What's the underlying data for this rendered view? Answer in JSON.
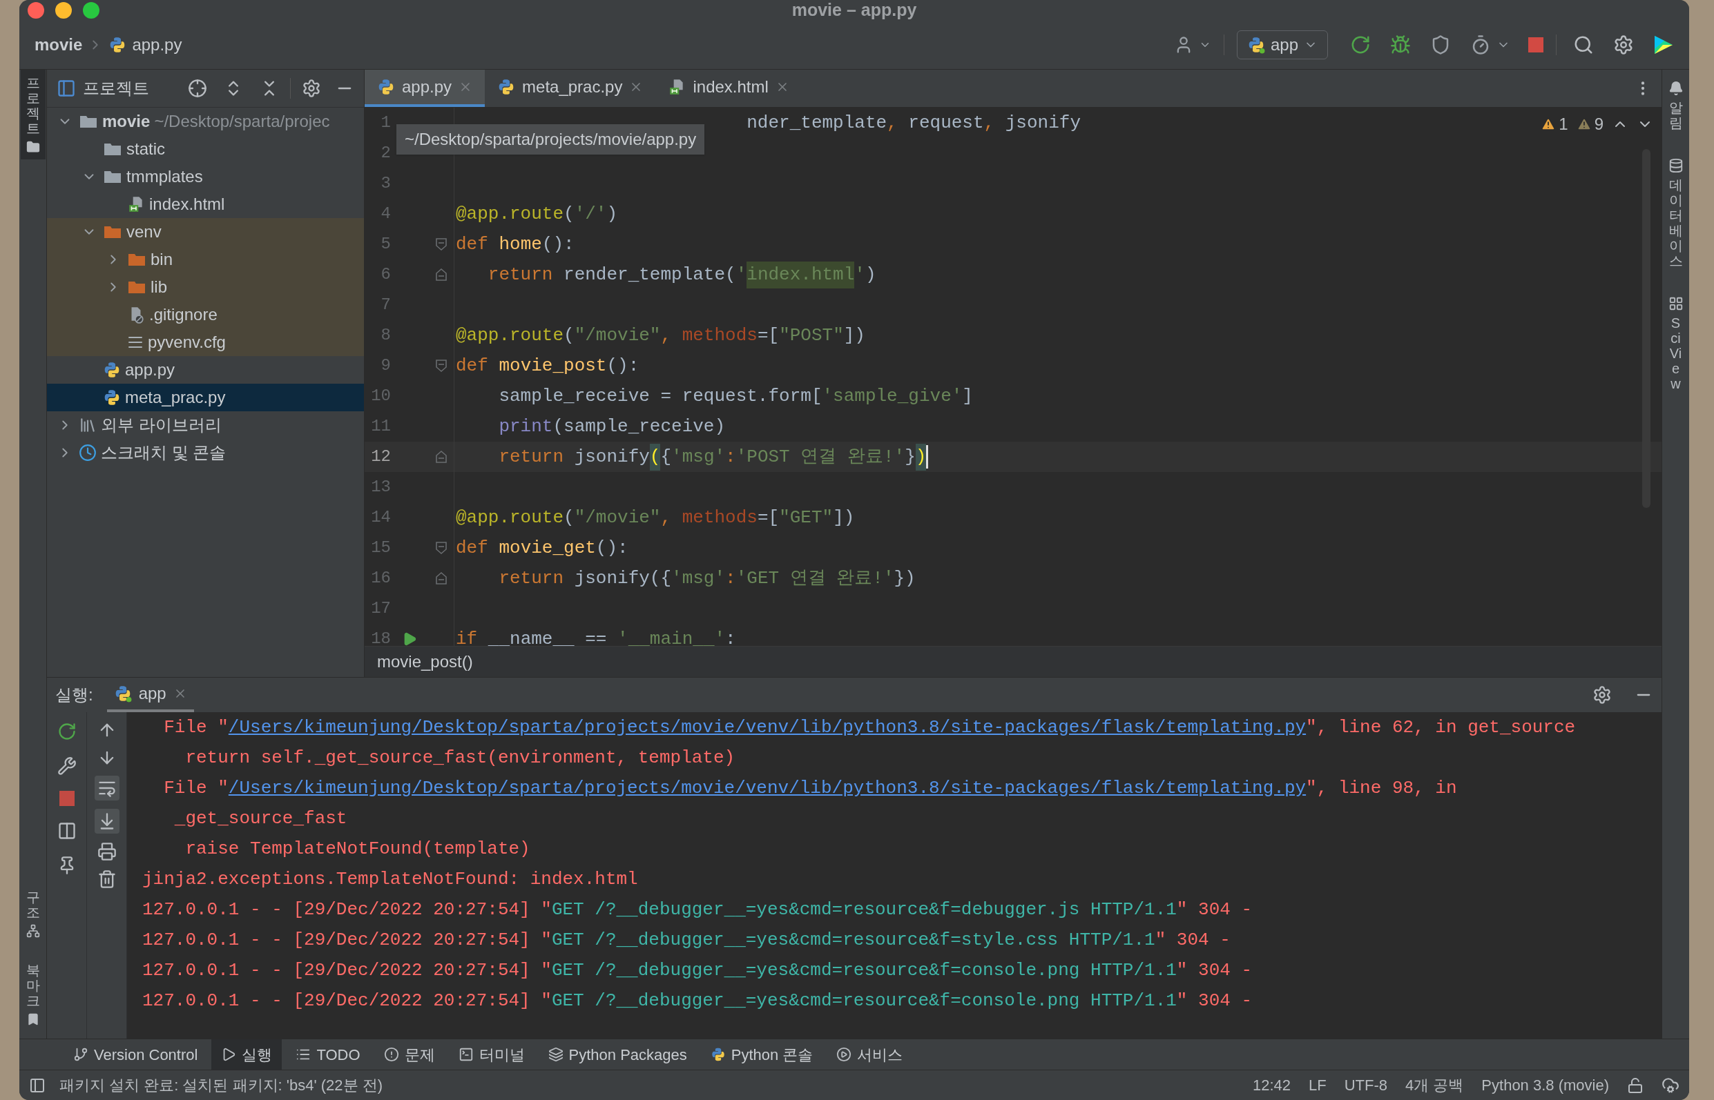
{
  "window": {
    "title": "movie – app.py"
  },
  "breadcrumb": [
    "movie",
    "app.py"
  ],
  "toolbar": {
    "run_config": "app"
  },
  "left_tool_tabs": [
    {
      "label": "프로젝트",
      "selected": true
    }
  ],
  "left_bottom_tabs": [
    {
      "label": "구조",
      "selected": false
    },
    {
      "label": "북마크",
      "selected": false
    }
  ],
  "right_tool_tabs": [
    {
      "label": "알림",
      "selected": false
    },
    {
      "label": "데이터베이스",
      "selected": false
    },
    {
      "label": "SciView",
      "selected": false
    }
  ],
  "project_panel": {
    "title": "프로젝트",
    "tree": [
      {
        "label": "movie",
        "hint": "~/Desktop/sparta/projec",
        "kind": "folder",
        "expanded": true,
        "selected": false,
        "excluded": false,
        "children": [
          {
            "label": "static",
            "kind": "folder",
            "selected": false,
            "excluded": false
          },
          {
            "label": "tmmplates",
            "kind": "folder",
            "expanded": true,
            "selected": false,
            "excluded": false,
            "children": [
              {
                "label": "index.html",
                "kind": "html",
                "selected": false,
                "excluded": false
              }
            ]
          },
          {
            "label": "venv",
            "kind": "folder",
            "expanded": true,
            "selected": false,
            "excluded": true,
            "children": [
              {
                "label": "bin",
                "kind": "folder",
                "expanded": false,
                "selected": false,
                "excluded": true
              },
              {
                "label": "lib",
                "kind": "folder",
                "expanded": false,
                "selected": false,
                "excluded": true
              },
              {
                "label": ".gitignore",
                "kind": "ignore",
                "selected": false,
                "excluded": true
              },
              {
                "label": "pyvenv.cfg",
                "kind": "config",
                "selected": false,
                "excluded": true
              }
            ]
          },
          {
            "label": "app.py",
            "kind": "python",
            "selected": false,
            "excluded": false
          },
          {
            "label": "meta_prac.py",
            "kind": "python",
            "selected": true,
            "excluded": false
          }
        ]
      },
      {
        "label": "외부 라이브러리",
        "kind": "library",
        "expanded": false,
        "selected": false,
        "excluded": false
      },
      {
        "label": "스크래치 및 콘솔",
        "kind": "scratch",
        "expanded": false,
        "selected": false,
        "excluded": false
      }
    ]
  },
  "editor": {
    "tabs": [
      {
        "label": "app.py",
        "kind": "python",
        "selected": true
      },
      {
        "label": "meta_prac.py",
        "kind": "python",
        "selected": false
      },
      {
        "label": "index.html",
        "kind": "html",
        "selected": false
      }
    ],
    "tooltip": "~/Desktop/sparta/projects/movie/app.py",
    "inspections": [
      {
        "count": "1",
        "kind": "warning"
      },
      {
        "count": "9",
        "kind": "weak"
      }
    ],
    "lines": [
      {
        "number": "1",
        "current": false,
        "tokens": [
          {
            "kind": "plain",
            "t": "                           nder_template"
          },
          {
            "kind": "kw",
            "t": ", "
          },
          {
            "kind": "plain",
            "t": "request"
          },
          {
            "kind": "kw",
            "t": ", "
          },
          {
            "kind": "plain",
            "t": "jsonify"
          }
        ]
      },
      {
        "number": "2",
        "current": false
      },
      {
        "number": "3",
        "current": false
      },
      {
        "number": "4",
        "current": false,
        "tokens": [
          {
            "kind": "deco",
            "t": "@app.route"
          },
          {
            "kind": "plain",
            "t": "("
          },
          {
            "kind": "str",
            "t": "'/'"
          },
          {
            "kind": "plain",
            "t": ")"
          }
        ]
      },
      {
        "number": "5",
        "current": false,
        "fold": {
          "kind": "start"
        },
        "tokens": [
          {
            "kind": "kw",
            "t": "def "
          },
          {
            "kind": "fn",
            "t": "home"
          },
          {
            "kind": "plain",
            "t": "():"
          }
        ]
      },
      {
        "number": "6",
        "current": false,
        "fold": {
          "kind": "end"
        },
        "tokens": [
          {
            "kind": "kw",
            "t": "   return"
          },
          {
            "kind": "plain",
            "t": " render_template("
          },
          {
            "kind": "str",
            "t": "'"
          },
          {
            "kind": "hl",
            "t": "index.html"
          },
          {
            "kind": "str",
            "t": "'"
          },
          {
            "kind": "plain",
            "t": ")"
          }
        ]
      },
      {
        "number": "7",
        "current": false
      },
      {
        "number": "8",
        "current": false,
        "tokens": [
          {
            "kind": "deco",
            "t": "@app.route"
          },
          {
            "kind": "plain",
            "t": "("
          },
          {
            "kind": "str",
            "t": "\"/movie\""
          },
          {
            "kind": "kw",
            "t": ", "
          },
          {
            "kind": "param",
            "t": "methods"
          },
          {
            "kind": "plain",
            "t": "=["
          },
          {
            "kind": "str",
            "t": "\"POST\""
          },
          {
            "kind": "plain",
            "t": "])"
          }
        ]
      },
      {
        "number": "9",
        "current": false,
        "fold": {
          "kind": "start"
        },
        "tokens": [
          {
            "kind": "kw",
            "t": "def "
          },
          {
            "kind": "fn",
            "t": "movie_post"
          },
          {
            "kind": "plain",
            "t": "():"
          }
        ]
      },
      {
        "number": "10",
        "current": false,
        "tokens": [
          {
            "kind": "plain",
            "t": "    sample_receive = request.form["
          },
          {
            "kind": "str",
            "t": "'sample_give'"
          },
          {
            "kind": "plain",
            "t": "]"
          }
        ]
      },
      {
        "number": "11",
        "current": false,
        "tokens": [
          {
            "kind": "builtin",
            "t": "    print"
          },
          {
            "kind": "plain",
            "t": "(sample_receive)"
          }
        ]
      },
      {
        "number": "12",
        "current": true,
        "fold": {
          "kind": "end"
        },
        "tokens": [
          {
            "kind": "kw",
            "t": "    return"
          },
          {
            "kind": "plain",
            "t": " jsonify"
          },
          {
            "kind": "brace",
            "t": "("
          },
          {
            "kind": "plain",
            "t": "{"
          },
          {
            "kind": "str",
            "t": "'msg'"
          },
          {
            "kind": "kw",
            "t": ":"
          },
          {
            "kind": "str",
            "t": "'POST 연결 완료!'"
          },
          {
            "kind": "plain",
            "t": "}"
          },
          {
            "kind": "brace",
            "t": ")"
          }
        ]
      },
      {
        "number": "13",
        "current": false
      },
      {
        "number": "14",
        "current": false,
        "tokens": [
          {
            "kind": "deco",
            "t": "@app.route"
          },
          {
            "kind": "plain",
            "t": "("
          },
          {
            "kind": "str",
            "t": "\"/movie\""
          },
          {
            "kind": "kw",
            "t": ", "
          },
          {
            "kind": "param",
            "t": "methods"
          },
          {
            "kind": "plain",
            "t": "=["
          },
          {
            "kind": "str",
            "t": "\"GET\""
          },
          {
            "kind": "plain",
            "t": "])"
          }
        ]
      },
      {
        "number": "15",
        "current": false,
        "fold": {
          "kind": "start"
        },
        "tokens": [
          {
            "kind": "kw",
            "t": "def "
          },
          {
            "kind": "fn",
            "t": "movie_get"
          },
          {
            "kind": "plain",
            "t": "():"
          }
        ]
      },
      {
        "number": "16",
        "current": false,
        "fold": {
          "kind": "end"
        },
        "tokens": [
          {
            "kind": "kw",
            "t": "    return"
          },
          {
            "kind": "plain",
            "t": " jsonify({"
          },
          {
            "kind": "str",
            "t": "'msg'"
          },
          {
            "kind": "kw",
            "t": ":"
          },
          {
            "kind": "str",
            "t": "'GET 연결 완료!'"
          },
          {
            "kind": "plain",
            "t": "})"
          }
        ]
      },
      {
        "number": "17",
        "current": false
      },
      {
        "number": "18",
        "current": false,
        "run": true,
        "tokens": [
          {
            "kind": "kw",
            "t": "if"
          },
          {
            "kind": "plain",
            "t": " __name__ == "
          },
          {
            "kind": "str",
            "t": "'__main__'"
          },
          {
            "kind": "plain",
            "t": ":"
          }
        ]
      }
    ],
    "breadcrumb": "movie_post()"
  },
  "run_panel": {
    "label": "실행:",
    "tab": "app",
    "lines": [
      {
        "tokens": [
          {
            "kind": "err",
            "t": "  File \""
          },
          {
            "kind": "link",
            "t": "/Users/kimeunjung/Desktop/sparta/projects/movie/venv/lib/python3.8/site-packages/flask/templating.py"
          },
          {
            "kind": "err",
            "t": "\", line 62, in get_source"
          }
        ]
      },
      {
        "tokens": [
          {
            "kind": "err",
            "t": "    return self._get_source_fast(environment, template)"
          }
        ]
      },
      {
        "tokens": [
          {
            "kind": "err",
            "t": "  File \""
          },
          {
            "kind": "link",
            "t": "/Users/kimeunjung/Desktop/sparta/projects/movie/venv/lib/python3.8/site-packages/flask/templating.py"
          },
          {
            "kind": "err",
            "t": "\", line 98, in"
          }
        ]
      },
      {
        "tokens": [
          {
            "kind": "err",
            "t": "   _get_source_fast"
          }
        ]
      },
      {
        "tokens": [
          {
            "kind": "err",
            "t": "    raise TemplateNotFound(template)"
          }
        ]
      },
      {
        "tokens": [
          {
            "kind": "err",
            "t": "jinja2.exceptions.TemplateNotFound: index.html"
          }
        ]
      },
      {
        "tokens": [
          {
            "kind": "err",
            "t": "127.0.0.1 - - [29/Dec/2022 20:27:54] \""
          },
          {
            "kind": "ok",
            "t": "GET /?__debugger__=yes&cmd=resource&f=debugger.js HTTP/1.1"
          },
          {
            "kind": "err",
            "t": "\" 304 -"
          }
        ]
      },
      {
        "tokens": [
          {
            "kind": "err",
            "t": "127.0.0.1 - - [29/Dec/2022 20:27:54] \""
          },
          {
            "kind": "ok",
            "t": "GET /?__debugger__=yes&cmd=resource&f=style.css HTTP/1.1"
          },
          {
            "kind": "err",
            "t": "\" 304 -"
          }
        ]
      },
      {
        "tokens": [
          {
            "kind": "err",
            "t": "127.0.0.1 - - [29/Dec/2022 20:27:54] \""
          },
          {
            "kind": "ok",
            "t": "GET /?__debugger__=yes&cmd=resource&f=console.png HTTP/1.1"
          },
          {
            "kind": "err",
            "t": "\" 304 -"
          }
        ]
      },
      {
        "tokens": [
          {
            "kind": "err",
            "t": "127.0.0.1 - - [29/Dec/2022 20:27:54] \""
          },
          {
            "kind": "ok",
            "t": "GET /?__debugger__=yes&cmd=resource&f=console.png HTTP/1.1"
          },
          {
            "kind": "err",
            "t": "\" 304 -"
          }
        ]
      }
    ]
  },
  "tool_tabs": [
    {
      "label": "Version Control",
      "selected": false
    },
    {
      "label": "실행",
      "selected": true
    },
    {
      "label": "TODO",
      "selected": false
    },
    {
      "label": "문제",
      "selected": false
    },
    {
      "label": "터미널",
      "selected": false
    },
    {
      "label": "Python Packages",
      "selected": false
    },
    {
      "label": "Python 콘솔",
      "selected": false
    },
    {
      "label": "서비스",
      "selected": false
    }
  ],
  "status": {
    "message": "패키지 설치 완료: 설치된 패키지: 'bs4' (22분 전)",
    "items": [
      "12:42",
      "LF",
      "UTF-8",
      "4개 공백",
      "Python 3.8 (movie)"
    ]
  }
}
